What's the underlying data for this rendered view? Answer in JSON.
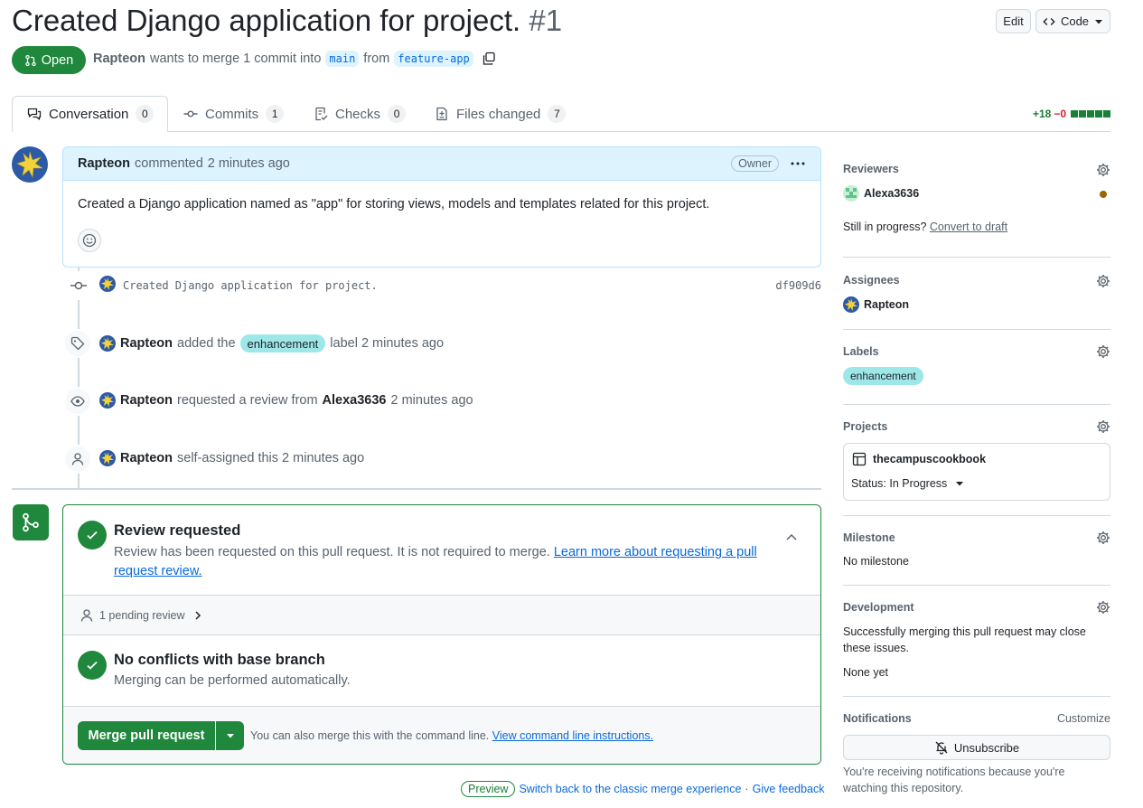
{
  "pr": {
    "title": "Created Django application for project.",
    "number": "#1",
    "state": "Open",
    "author": "Rapteon",
    "merge_text_1": "wants to merge 1 commit into",
    "base_branch": "main",
    "merge_text_2": "from",
    "head_branch": "feature-app"
  },
  "header_buttons": {
    "edit": "Edit",
    "code": "Code"
  },
  "tabs": [
    {
      "label": "Conversation",
      "count": "0",
      "icon": "comment-discussion-icon"
    },
    {
      "label": "Commits",
      "count": "1",
      "icon": "git-commit-icon"
    },
    {
      "label": "Checks",
      "count": "0",
      "icon": "checklist-icon"
    },
    {
      "label": "Files changed",
      "count": "7",
      "icon": "file-diff-icon"
    }
  ],
  "diffstat": {
    "additions": "+18",
    "deletions": "−0"
  },
  "comment": {
    "author": "Rapteon",
    "action": "commented",
    "time": "2 minutes ago",
    "badge": "Owner",
    "body": "Created a Django application named as \"app\" for storing views, models and templates related for this project."
  },
  "timeline": {
    "commit": {
      "message": "Created Django application for project.",
      "sha": "df909d6"
    },
    "label_event": {
      "actor": "Rapteon",
      "text1": "added the",
      "label": "enhancement",
      "text2": "label 2 minutes ago"
    },
    "review_event": {
      "actor": "Rapteon",
      "text1": "requested a review from",
      "reviewer": "Alexa3636",
      "text2": "2 minutes ago"
    },
    "assign_event": {
      "actor": "Rapteon",
      "text": "self-assigned this 2 minutes ago"
    }
  },
  "merge_box": {
    "review_title": "Review requested",
    "review_desc": "Review has been requested on this pull request. It is not required to merge.",
    "review_link": "Learn more about requesting a pull request review.",
    "pending": "1 pending review",
    "conflict_title": "No conflicts with base branch",
    "conflict_desc": "Merging can be performed automatically.",
    "merge_button": "Merge pull request",
    "cli_text": "You can also merge this with the command line.",
    "cli_link": "View command line instructions."
  },
  "footer": {
    "preview_badge": "Preview",
    "switch_link": "Switch back to the classic merge experience",
    "separator": "·",
    "feedback_link": "Give feedback"
  },
  "sidebar": {
    "reviewers": {
      "heading": "Reviewers",
      "name": "Alexa3636",
      "draft_text": "Still in progress?",
      "draft_link": "Convert to draft"
    },
    "assignees": {
      "heading": "Assignees",
      "name": "Rapteon"
    },
    "labels": {
      "heading": "Labels",
      "label": "enhancement"
    },
    "projects": {
      "heading": "Projects",
      "name": "thecampuscookbook",
      "status": "Status: In Progress"
    },
    "milestone": {
      "heading": "Milestone",
      "value": "No milestone"
    },
    "development": {
      "heading": "Development",
      "desc": "Successfully merging this pull request may close these issues.",
      "value": "None yet"
    },
    "notifications": {
      "heading": "Notifications",
      "customize": "Customize",
      "button": "Unsubscribe",
      "desc": "You're receiving notifications because you're watching this repository."
    }
  },
  "colors": {
    "green": "#1f883d",
    "blue": "#0969da",
    "label_bg": "#9ee7e8",
    "comment_header_bg": "#ddf4ff",
    "pending_dot": "#9a6700"
  }
}
